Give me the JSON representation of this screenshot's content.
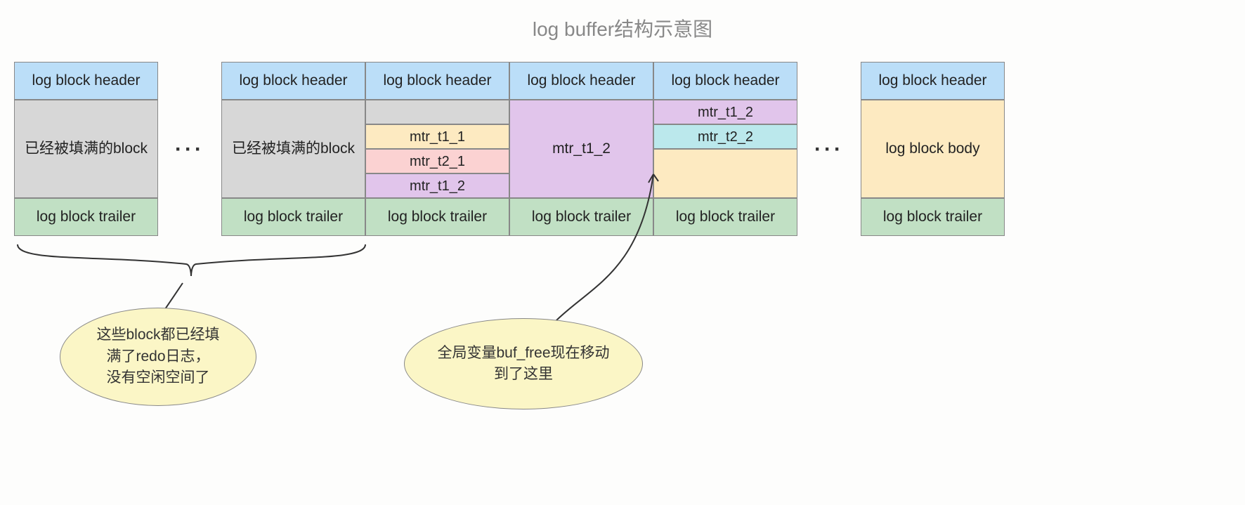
{
  "title": "log buffer结构示意图",
  "labels": {
    "header": "log block header",
    "trailer": "log block trailer",
    "body": "log block body",
    "full_block": "已经被填满的block",
    "mtr_t1_1": "mtr_t1_1",
    "mtr_t2_1": "mtr_t2_1",
    "mtr_t1_2": "mtr_t1_2",
    "mtr_t2_2": "mtr_t2_2",
    "ellipsis": "···"
  },
  "callouts": {
    "left": "这些block都已经填\n满了redo日志，\n没有空闲空间了",
    "right": "全局变量buf_free现在移动\n到了这里"
  },
  "colors": {
    "header": "#bbdef8",
    "trailer": "#c1e0c4",
    "full": "#d7d7d7",
    "orange": "#fdeac1",
    "pink": "#fbd2d2",
    "purple": "#e1c5eb",
    "cyan": "#bbe8ec",
    "bubble": "#fbf6c6"
  }
}
